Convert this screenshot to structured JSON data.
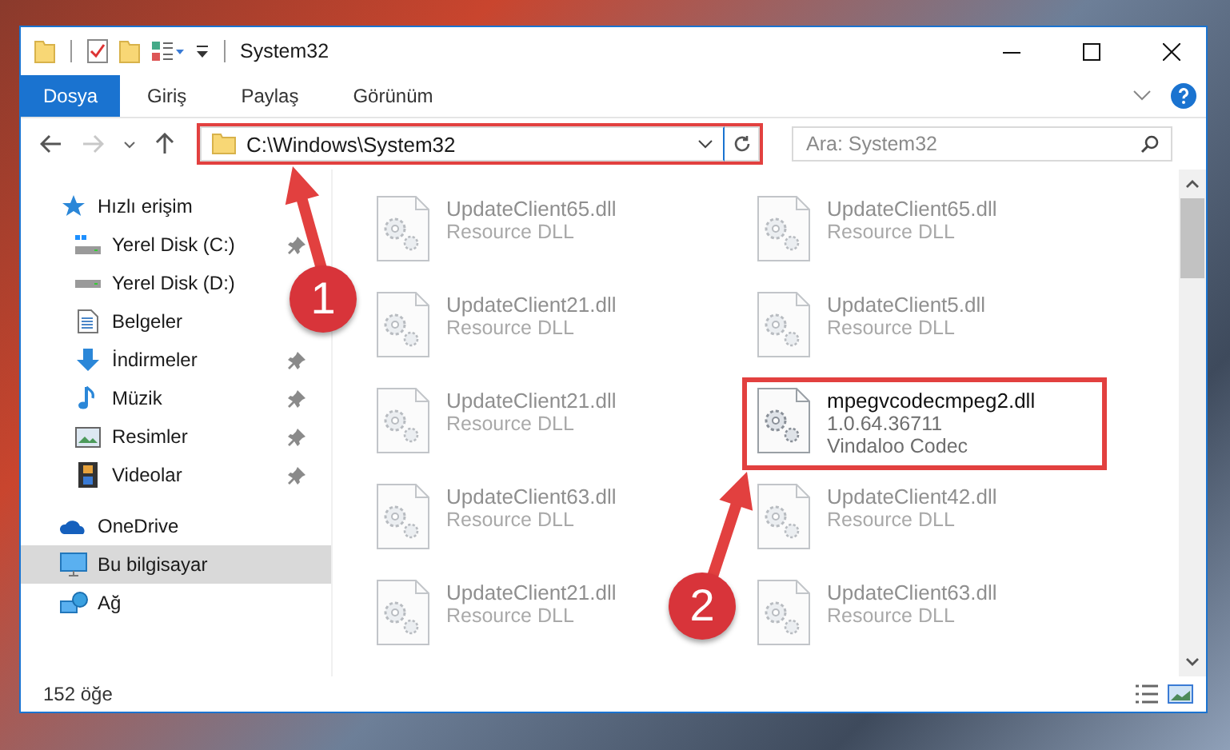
{
  "window": {
    "title": "System32"
  },
  "ribbon": {
    "tabs": [
      {
        "label": "Dosya",
        "kind": "file",
        "selected": false
      },
      {
        "label": "Giriş",
        "kind": "tab",
        "selected": false
      },
      {
        "label": "Paylaş",
        "kind": "tab",
        "selected": false
      },
      {
        "label": "Görünüm",
        "kind": "tab",
        "selected": false
      }
    ]
  },
  "navigation": {
    "forward_disabled": true
  },
  "address_bar": {
    "path": "C:\\Windows\\System32",
    "annotated": true
  },
  "search": {
    "placeholder": "Ara: System32"
  },
  "sidebar": {
    "items": [
      {
        "label": "Hızlı erişim",
        "selected": false,
        "children": [
          {
            "label": "Yerel Disk (C:)",
            "pinned": true,
            "selected": false
          },
          {
            "label": "Yerel Disk (D:)",
            "pinned": false,
            "selected": false
          },
          {
            "label": "Belgeler",
            "pinned": false,
            "selected": false
          },
          {
            "label": "İndirmeler",
            "pinned": true,
            "selected": false
          },
          {
            "label": "Müzik",
            "pinned": true,
            "selected": false
          },
          {
            "label": "Resimler",
            "pinned": true,
            "selected": false
          },
          {
            "label": "Videolar",
            "pinned": true,
            "selected": false
          }
        ]
      },
      {
        "label": "OneDrive",
        "selected": false
      },
      {
        "label": "Bu bilgisayar",
        "selected": true
      },
      {
        "label": "Ağ",
        "selected": false
      }
    ]
  },
  "files": [
    {
      "name": "UpdateClient65.dll",
      "details": [
        "Resource DLL"
      ],
      "blurred": true,
      "annotated": false
    },
    {
      "name": "UpdateClient65.dll",
      "details": [
        "Resource DLL"
      ],
      "blurred": true,
      "annotated": false
    },
    {
      "name": "UpdateClient21.dll",
      "details": [
        "Resource DLL"
      ],
      "blurred": true,
      "annotated": false
    },
    {
      "name": "UpdateClient5.dll",
      "details": [
        "Resource DLL"
      ],
      "blurred": true,
      "annotated": false
    },
    {
      "name": "UpdateClient21.dll",
      "details": [
        "Resource DLL"
      ],
      "blurred": true,
      "annotated": false
    },
    {
      "name": "mpegvcodecmpeg2.dll",
      "details": [
        "1.0.64.36711",
        "Vindaloo Codec"
      ],
      "blurred": false,
      "annotated": true
    },
    {
      "name": "UpdateClient63.dll",
      "details": [
        "Resource DLL"
      ],
      "blurred": true,
      "annotated": false
    },
    {
      "name": "UpdateClient42.dll",
      "details": [
        "Resource DLL"
      ],
      "blurred": true,
      "annotated": false
    },
    {
      "name": "UpdateClient21.dll",
      "details": [
        "Resource DLL"
      ],
      "blurred": true,
      "annotated": false
    },
    {
      "name": "UpdateClient63.dll",
      "details": [
        "Resource DLL"
      ],
      "blurred": true,
      "annotated": false
    }
  ],
  "status_bar": {
    "count": "152 öğe"
  },
  "annotations": [
    {
      "label": "1"
    },
    {
      "label": "2"
    }
  ]
}
